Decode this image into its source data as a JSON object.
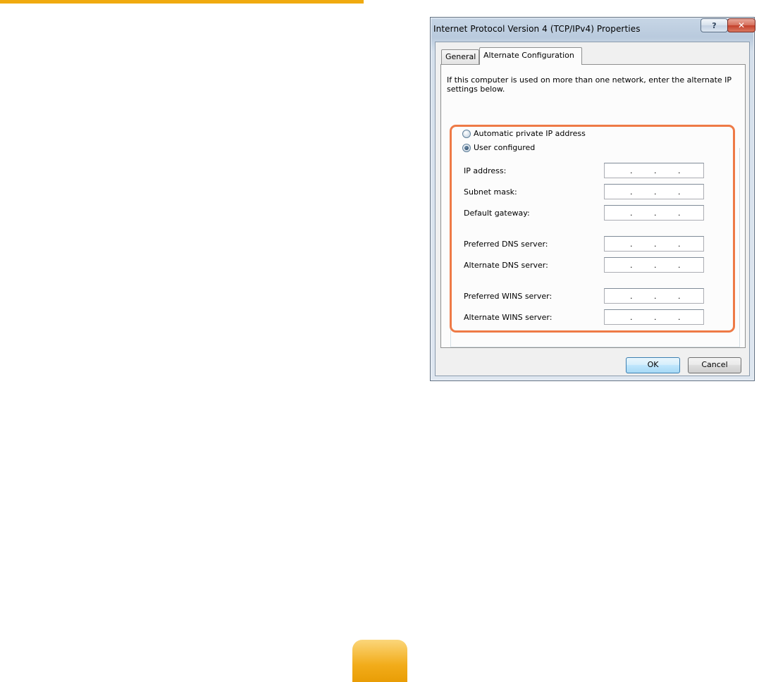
{
  "dialog": {
    "title": "Internet Protocol Version 4 (TCP/IPv4) Properties",
    "help_glyph": "?",
    "close_glyph": "✕",
    "tabs": [
      {
        "label": "General",
        "selected": false
      },
      {
        "label": "Alternate Configuration",
        "selected": true
      }
    ],
    "description": "If this computer is used on more than one network, enter the alternate IP settings below.",
    "options": {
      "automatic_label": "Automatic private IP address",
      "user_label": "User configured",
      "selected": "user"
    },
    "fields": {
      "ip_address": {
        "label": "IP address:",
        "value": ". . ."
      },
      "subnet_mask": {
        "label": "Subnet mask:",
        "value": ". . ."
      },
      "default_gateway": {
        "label": "Default gateway:",
        "value": ". . ."
      },
      "preferred_dns": {
        "label": "Preferred DNS server:",
        "value": ". . ."
      },
      "alternate_dns": {
        "label": "Alternate DNS server:",
        "value": ". . ."
      },
      "preferred_wins": {
        "label": "Preferred WINS server:",
        "value": ". . ."
      },
      "alternate_wins": {
        "label": "Alternate WINS server:",
        "value": ". . ."
      }
    },
    "buttons": {
      "ok": "OK",
      "cancel": "Cancel"
    }
  },
  "colors": {
    "highlight": "#ee7a46",
    "page_accent": "#f0aa0f"
  }
}
